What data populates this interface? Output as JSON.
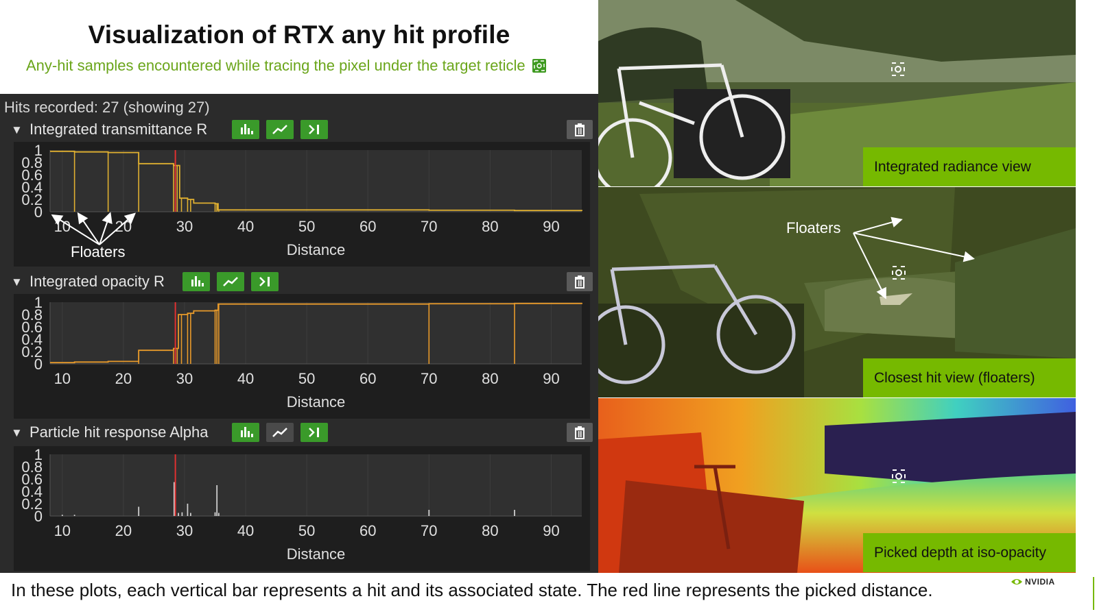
{
  "title": "Visualization of RTX any hit profile",
  "subtitle": "Any-hit samples encountered while tracing the pixel under the target reticle",
  "hits_recorded": "Hits recorded: 27 (showing 27)",
  "sections": [
    {
      "label": "Integrated transmittance R",
      "color": "#e0b030",
      "buttons": {
        "bars": true,
        "line": true,
        "jump": true
      }
    },
    {
      "label": "Integrated opacity R",
      "color": "#e89a2a",
      "buttons": {
        "bars": true,
        "line": true,
        "jump": true
      }
    },
    {
      "label": "Particle hit response Alpha",
      "color": "#cfcfcf",
      "buttons": {
        "bars": true,
        "line": false,
        "jump": true
      }
    }
  ],
  "annotation_left": "Floaters",
  "annotation_right": "Floaters",
  "views": [
    {
      "label": "Integrated radiance view"
    },
    {
      "label": "Closest hit view (floaters)"
    },
    {
      "label": "Picked depth at iso-opacity"
    }
  ],
  "caption": "In these plots, each vertical bar represents a hit and its associated state. The red line represents the picked distance.",
  "logo_text": "NVIDIA",
  "chart_data": [
    {
      "type": "line",
      "title": "Integrated transmittance R",
      "xlabel": "Distance",
      "ylabel": "",
      "xlim": [
        8,
        95
      ],
      "ylim": [
        0,
        1
      ],
      "xticks": [
        10,
        20,
        30,
        40,
        50,
        60,
        70,
        80,
        90
      ],
      "yticks": [
        "0",
        "0.2",
        "0.4",
        "0.6",
        "0.8",
        "1"
      ],
      "picked_distance": 28.5,
      "x": [
        8,
        12,
        17.5,
        22.5,
        28.2,
        29.2,
        30.5,
        31.5,
        35,
        35.5,
        50,
        70,
        84,
        95
      ],
      "y": [
        0.98,
        0.97,
        0.96,
        0.78,
        0.75,
        0.22,
        0.2,
        0.14,
        0.13,
        0.03,
        0.03,
        0.025,
        0.02,
        0.01
      ],
      "hits": [
        12,
        17.5,
        22.5,
        28.2,
        28.8,
        29.5,
        30.5,
        31,
        35,
        35.3,
        35.6
      ]
    },
    {
      "type": "line",
      "title": "Integrated opacity R",
      "xlabel": "Distance",
      "ylabel": "",
      "xlim": [
        8,
        95
      ],
      "ylim": [
        0,
        1
      ],
      "xticks": [
        10,
        20,
        30,
        40,
        50,
        60,
        70,
        80,
        90
      ],
      "yticks": [
        "0",
        "0.2",
        "0.4",
        "0.6",
        "0.8",
        "1"
      ],
      "picked_distance": 28.5,
      "x": [
        8,
        12,
        17.5,
        22.5,
        28.2,
        29,
        30.5,
        31.5,
        35,
        35.5,
        70,
        84,
        95
      ],
      "y": [
        0.02,
        0.03,
        0.04,
        0.22,
        0.25,
        0.8,
        0.82,
        0.86,
        0.87,
        0.97,
        0.975,
        0.98,
        0.99
      ],
      "hits": [
        22.5,
        28.2,
        28.8,
        29.5,
        30.5,
        31,
        35,
        35.3,
        35.6,
        70,
        84
      ]
    },
    {
      "type": "bar",
      "title": "Particle hit response Alpha",
      "xlabel": "Distance",
      "ylabel": "",
      "xlim": [
        8,
        95
      ],
      "ylim": [
        0,
        1
      ],
      "xticks": [
        10,
        20,
        30,
        40,
        50,
        60,
        70,
        80,
        90
      ],
      "yticks": [
        "0",
        "0.2",
        "0.4",
        "0.6",
        "0.8",
        "1"
      ],
      "picked_distance": 28.5,
      "x": [
        10,
        12,
        22.5,
        28.3,
        29,
        29.6,
        30.5,
        31,
        35,
        35.3,
        35.6,
        70,
        84
      ],
      "values": [
        0.02,
        0.02,
        0.15,
        0.55,
        0.05,
        0.06,
        0.2,
        0.05,
        0.06,
        0.5,
        0.05,
        0.1,
        0.1
      ]
    }
  ]
}
